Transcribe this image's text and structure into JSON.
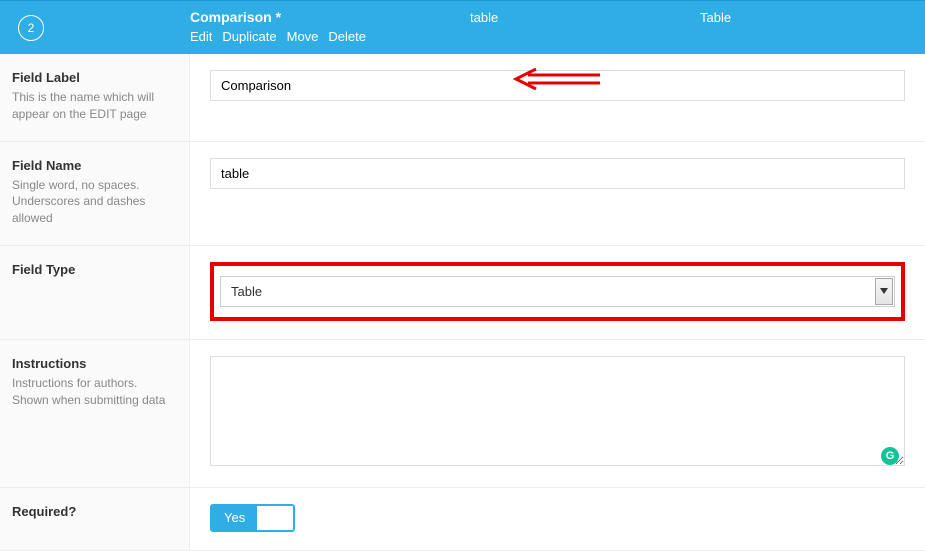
{
  "header": {
    "number": "2",
    "title": "Comparison *",
    "meta1": "table",
    "meta2": "Table",
    "actions": {
      "edit": "Edit",
      "duplicate": "Duplicate",
      "move": "Move",
      "delete": "Delete"
    }
  },
  "rows": {
    "field_label": {
      "title": "Field Label",
      "desc": "This is the name which will appear on the EDIT page",
      "value": "Comparison"
    },
    "field_name": {
      "title": "Field Name",
      "desc": "Single word, no spaces. Underscores and dashes allowed",
      "value": "table"
    },
    "field_type": {
      "title": "Field Type",
      "value": "Table"
    },
    "instructions": {
      "title": "Instructions",
      "desc": "Instructions for authors. Shown when submitting data",
      "value": ""
    },
    "required": {
      "title": "Required?",
      "value": "Yes"
    }
  },
  "icons": {
    "grammarly": "G"
  }
}
